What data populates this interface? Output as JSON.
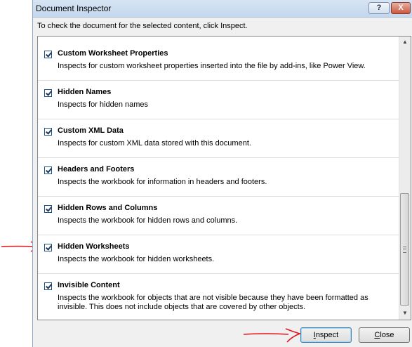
{
  "window": {
    "title": "Document Inspector",
    "help_label": "?",
    "close_label": "X"
  },
  "instruction": "To check the document for the selected content, click Inspect.",
  "items": [
    {
      "title": "Custom Worksheet Properties",
      "description": "Inspects for custom worksheet properties inserted into the file by add-ins, like Power View.",
      "checked": true
    },
    {
      "title": "Hidden Names",
      "description": "Inspects for hidden names",
      "checked": true
    },
    {
      "title": "Custom XML Data",
      "description": "Inspects for custom XML data stored with this document.",
      "checked": true
    },
    {
      "title": "Headers and Footers",
      "description": "Inspects the workbook for information in headers and footers.",
      "checked": true
    },
    {
      "title": "Hidden Rows and Columns",
      "description": "Inspects the workbook for hidden rows and columns.",
      "checked": true
    },
    {
      "title": "Hidden Worksheets",
      "description": "Inspects the workbook for hidden worksheets.",
      "checked": true
    },
    {
      "title": "Invisible Content",
      "description": "Inspects the workbook for objects that are not visible because they have been formatted as invisible. This does not include objects that are covered by other objects.",
      "checked": true
    }
  ],
  "buttons": {
    "inspect": "Inspect",
    "close": "Close"
  },
  "colors": {
    "annotation_arrow": "#e0151b",
    "title_bar": "#c3d7ee"
  }
}
